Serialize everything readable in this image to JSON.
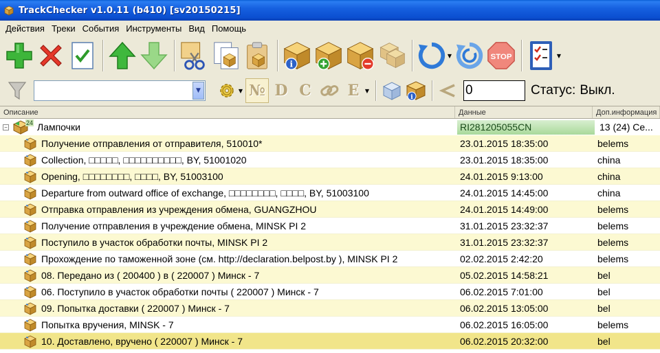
{
  "window": {
    "title": "TrackChecker v1.0.11 (b410)  [sv20150215]"
  },
  "menu": [
    "Действия",
    "Треки",
    "События",
    "Инструменты",
    "Вид",
    "Помощь"
  ],
  "toolbar2": {
    "number_value": "0",
    "status_label": "Статус:",
    "status_value": "Выкл.",
    "letters": [
      "№",
      "D",
      "C",
      "E"
    ]
  },
  "list": {
    "headers": [
      "Описание",
      "Данные",
      "Доп.информация"
    ],
    "group": {
      "label": "Лампочки",
      "badge": "24",
      "data": "RI281205055CN",
      "info": "13 (24) Се..."
    },
    "rows": [
      {
        "desc": "Получение отправления от отправителя, 510010*",
        "date": "23.01.2015 18:35:00",
        "info": "belems"
      },
      {
        "desc": "Collection, □□□□□, □□□□□□□□□□, BY, 51001020",
        "date": "23.01.2015 18:35:00",
        "info": "china"
      },
      {
        "desc": "Opening, □□□□□□□□, □□□□, BY, 51003100",
        "date": "24.01.2015 9:13:00",
        "info": "china"
      },
      {
        "desc": "Departure from outward office of exchange, □□□□□□□□, □□□□, BY, 51003100",
        "date": "24.01.2015 14:45:00",
        "info": "china"
      },
      {
        "desc": "Отправка отправления из учреждения обмена, GUANGZHOU",
        "date": "24.01.2015 14:49:00",
        "info": "belems"
      },
      {
        "desc": "Получение отправления в учреждение обмена, MINSK PI 2",
        "date": "31.01.2015 23:32:37",
        "info": "belems"
      },
      {
        "desc": "Поступило в участок обработки почты, MINSK PI 2",
        "date": "31.01.2015 23:32:37",
        "info": "belems"
      },
      {
        "desc": "Прохождение по таможенной зоне (см. http://declaration.belpost.by ), MINSK PI 2",
        "date": "02.02.2015 2:42:20",
        "info": "belems"
      },
      {
        "desc": "08. Передано из ( 200400 ) в ( 220007 ) Минск - 7",
        "date": "05.02.2015 14:58:21",
        "info": "bel"
      },
      {
        "desc": "06. Поступило в участок обработки почты ( 220007 ) Минск - 7",
        "date": "06.02.2015 7:01:00",
        "info": "bel"
      },
      {
        "desc": "09. Попытка доставки ( 220007 ) Минск - 7",
        "date": "06.02.2015 13:05:00",
        "info": "bel"
      },
      {
        "desc": "Попытка вручения, MINSK - 7",
        "date": "06.02.2015 16:05:00",
        "info": "belems"
      },
      {
        "desc": "10. Доставлено, вручено ( 220007 ) Минск - 7",
        "date": "06.02.2015 20:32:00",
        "info": "bel"
      }
    ]
  }
}
